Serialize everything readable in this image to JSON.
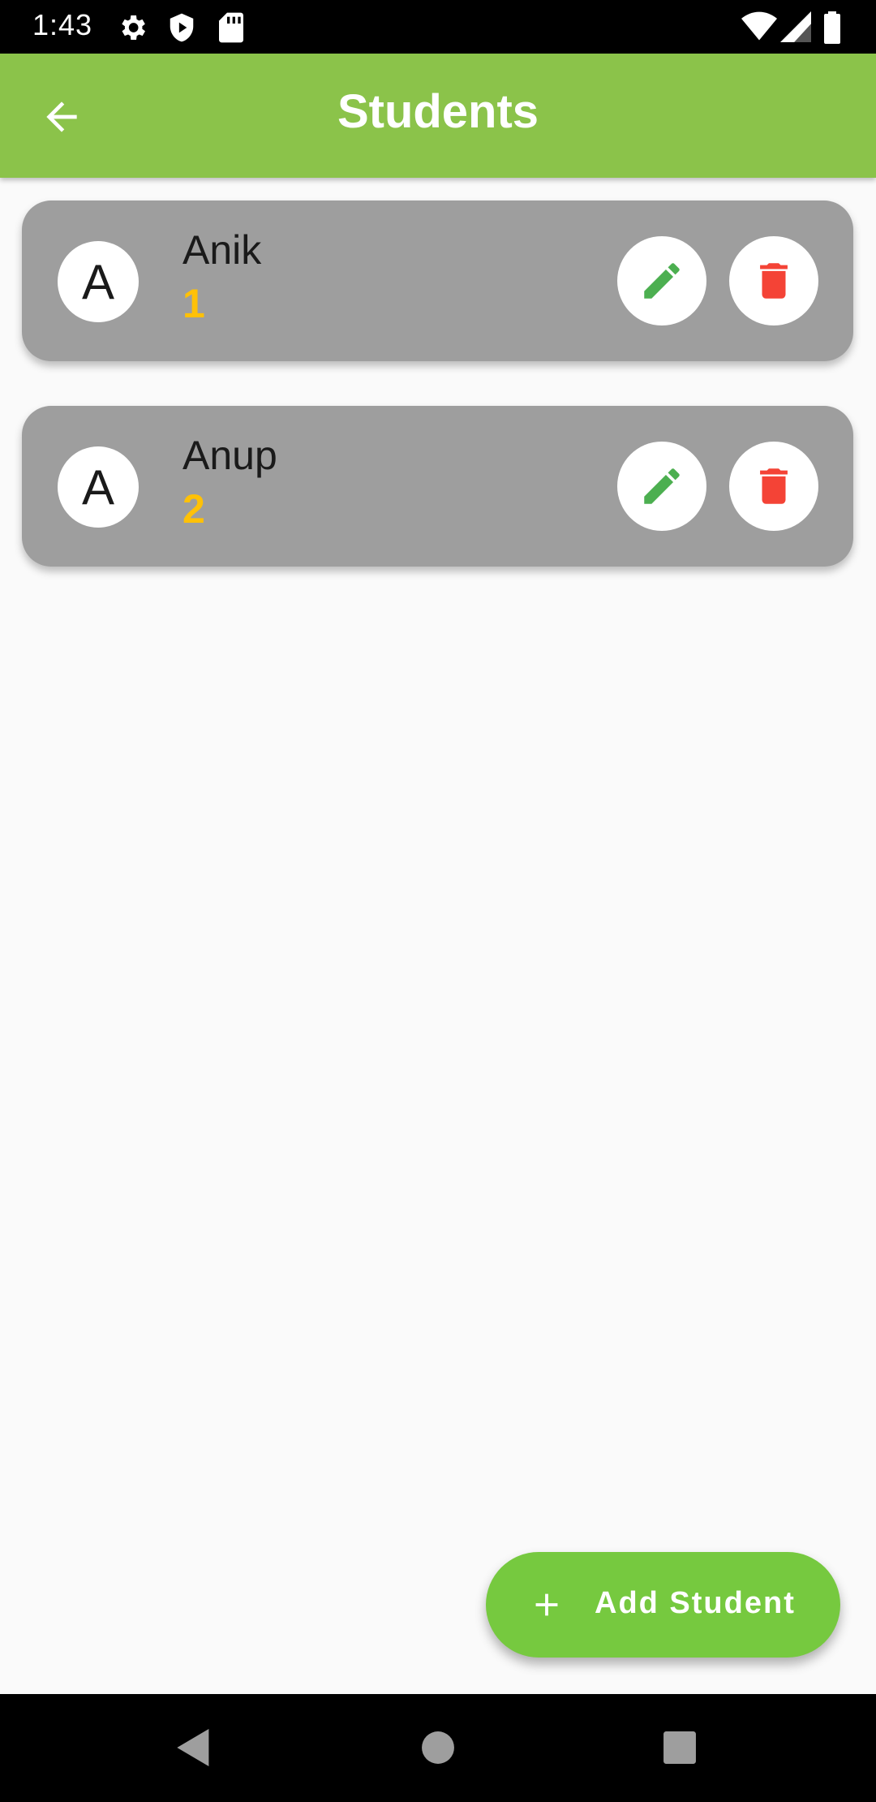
{
  "status_bar": {
    "time": "1:43",
    "icons": [
      "gear-icon",
      "shield-play-icon",
      "sd-card-icon",
      "wifi-icon",
      "signal-icon",
      "battery-icon"
    ]
  },
  "app_bar": {
    "title": "Students",
    "back_icon": "arrow-back-icon",
    "color": "#8bc34a"
  },
  "students": [
    {
      "initial": "A",
      "name": "Anik",
      "roll": "1"
    },
    {
      "initial": "A",
      "name": "Anup",
      "roll": "2"
    }
  ],
  "actions": {
    "edit_icon": "pencil-icon",
    "delete_icon": "trash-icon",
    "edit_color": "#4caf50",
    "delete_color": "#f44336"
  },
  "fab": {
    "label": "Add Student",
    "icon": "plus-icon",
    "color": "#76c93f"
  },
  "roll_color": "#ffc107",
  "card_color": "#9e9e9e",
  "nav_bar": {
    "buttons": [
      "back-triangle-icon",
      "home-circle-icon",
      "recents-square-icon"
    ]
  }
}
